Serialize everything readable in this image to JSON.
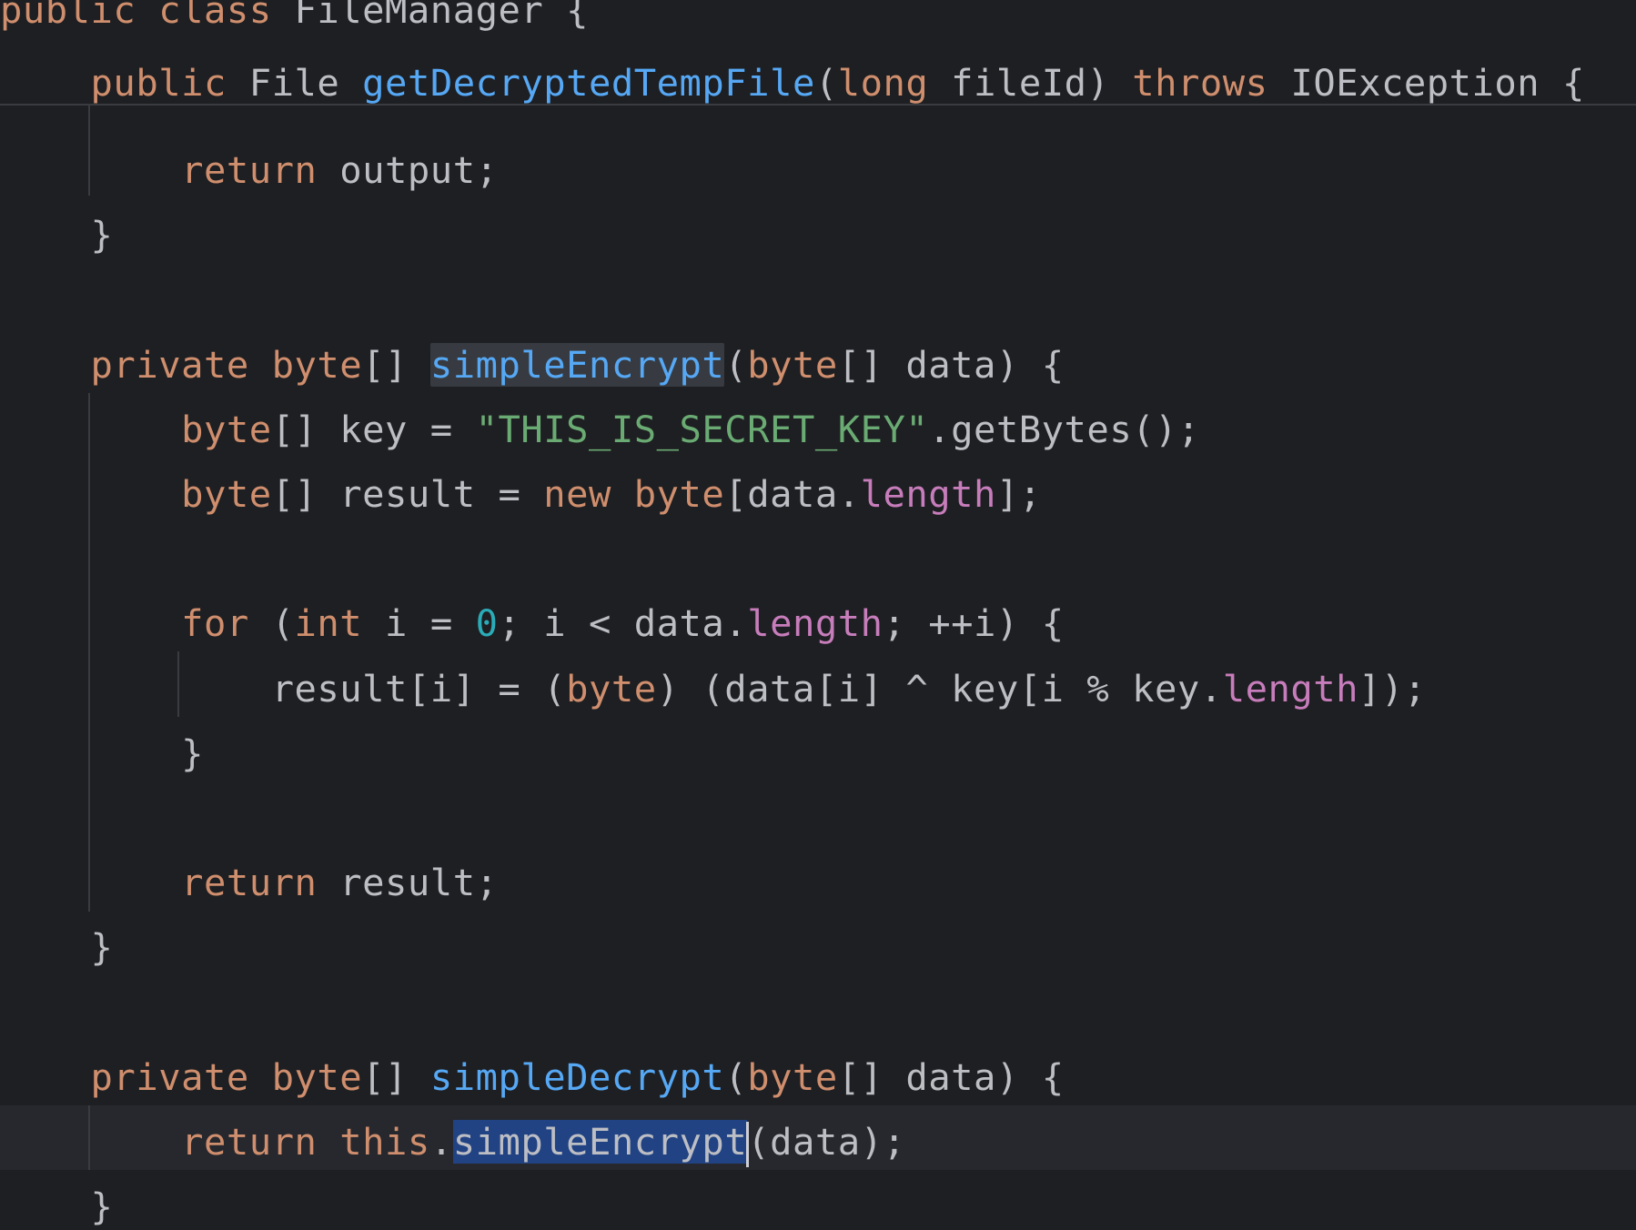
{
  "editor": {
    "colors": {
      "background": "#1e1f22",
      "keyword": "#cf8e6d",
      "function": "#56a8f5",
      "string": "#6aab73",
      "number": "#2aacb8",
      "field": "#c77dbb",
      "identifier": "#bcbec4",
      "selection": "#214283",
      "usage_highlight": "#373b41"
    },
    "sticky_lines": [
      {
        "tokens": [
          {
            "t": "public",
            "c": "kw"
          },
          {
            "t": " ",
            "c": "id"
          },
          {
            "t": "class",
            "c": "kw"
          },
          {
            "t": " FileManager {",
            "c": "id"
          }
        ]
      },
      {
        "tokens": [
          {
            "t": "    ",
            "c": "id"
          },
          {
            "t": "public",
            "c": "kw"
          },
          {
            "t": " File ",
            "c": "id"
          },
          {
            "t": "getDecryptedTempFile",
            "c": "fn"
          },
          {
            "t": "(",
            "c": "id"
          },
          {
            "t": "long",
            "c": "kw"
          },
          {
            "t": " fileId) ",
            "c": "id"
          },
          {
            "t": "throws",
            "c": "kw"
          },
          {
            "t": " IOException {",
            "c": "id"
          }
        ]
      }
    ],
    "lines": [
      {
        "tokens": [
          {
            "t": "        ",
            "c": "id"
          },
          {
            "t": "return",
            "c": "kw"
          },
          {
            "t": " output;",
            "c": "id"
          }
        ]
      },
      {
        "tokens": [
          {
            "t": "    }",
            "c": "id"
          }
        ]
      },
      {
        "tokens": []
      },
      {
        "tokens": [
          {
            "t": "    ",
            "c": "id"
          },
          {
            "t": "private",
            "c": "kw"
          },
          {
            "t": " ",
            "c": "id"
          },
          {
            "t": "byte",
            "c": "kw"
          },
          {
            "t": "[] ",
            "c": "id"
          },
          {
            "t": "simpleEncrypt",
            "c": "fn",
            "hl": "usage"
          },
          {
            "t": "(",
            "c": "id"
          },
          {
            "t": "byte",
            "c": "kw"
          },
          {
            "t": "[] data) {",
            "c": "id"
          }
        ]
      },
      {
        "tokens": [
          {
            "t": "        ",
            "c": "id"
          },
          {
            "t": "byte",
            "c": "kw"
          },
          {
            "t": "[] key = ",
            "c": "id"
          },
          {
            "t": "\"THIS_IS_SECRET_KEY\"",
            "c": "str"
          },
          {
            "t": ".getBytes();",
            "c": "id"
          }
        ]
      },
      {
        "tokens": [
          {
            "t": "        ",
            "c": "id"
          },
          {
            "t": "byte",
            "c": "kw"
          },
          {
            "t": "[] result = ",
            "c": "id"
          },
          {
            "t": "new",
            "c": "kw"
          },
          {
            "t": " ",
            "c": "id"
          },
          {
            "t": "byte",
            "c": "kw"
          },
          {
            "t": "[data.",
            "c": "id"
          },
          {
            "t": "length",
            "c": "fld"
          },
          {
            "t": "];",
            "c": "id"
          }
        ]
      },
      {
        "tokens": []
      },
      {
        "tokens": [
          {
            "t": "        ",
            "c": "id"
          },
          {
            "t": "for",
            "c": "kw"
          },
          {
            "t": " (",
            "c": "id"
          },
          {
            "t": "int",
            "c": "kw"
          },
          {
            "t": " i = ",
            "c": "id"
          },
          {
            "t": "0",
            "c": "num"
          },
          {
            "t": "; i < data.",
            "c": "id"
          },
          {
            "t": "length",
            "c": "fld"
          },
          {
            "t": "; ++i) {",
            "c": "id"
          }
        ]
      },
      {
        "tokens": [
          {
            "t": "            result[i] = (",
            "c": "id"
          },
          {
            "t": "byte",
            "c": "kw"
          },
          {
            "t": ") (data[i] ^ key[i % key.",
            "c": "id"
          },
          {
            "t": "length",
            "c": "fld"
          },
          {
            "t": "]);",
            "c": "id"
          }
        ]
      },
      {
        "tokens": [
          {
            "t": "        }",
            "c": "id"
          }
        ]
      },
      {
        "tokens": []
      },
      {
        "tokens": [
          {
            "t": "        ",
            "c": "id"
          },
          {
            "t": "return",
            "c": "kw"
          },
          {
            "t": " result;",
            "c": "id"
          }
        ]
      },
      {
        "tokens": [
          {
            "t": "    }",
            "c": "id"
          }
        ]
      },
      {
        "tokens": []
      },
      {
        "tokens": [
          {
            "t": "    ",
            "c": "id"
          },
          {
            "t": "private",
            "c": "kw"
          },
          {
            "t": " ",
            "c": "id"
          },
          {
            "t": "byte",
            "c": "kw"
          },
          {
            "t": "[] ",
            "c": "id"
          },
          {
            "t": "simpleDecrypt",
            "c": "fn"
          },
          {
            "t": "(",
            "c": "id"
          },
          {
            "t": "byte",
            "c": "kw"
          },
          {
            "t": "[] data) {",
            "c": "id"
          }
        ]
      },
      {
        "current": true,
        "tokens": [
          {
            "t": "        ",
            "c": "id"
          },
          {
            "t": "return",
            "c": "kw"
          },
          {
            "t": " ",
            "c": "id"
          },
          {
            "t": "this",
            "c": "kw"
          },
          {
            "t": ".",
            "c": "id"
          },
          {
            "t": "simpleEncrypt",
            "c": "id",
            "hl": "sel",
            "caret_after": true
          },
          {
            "t": "(data);",
            "c": "id"
          }
        ]
      },
      {
        "tokens": [
          {
            "t": "    }",
            "c": "id"
          }
        ]
      }
    ]
  }
}
